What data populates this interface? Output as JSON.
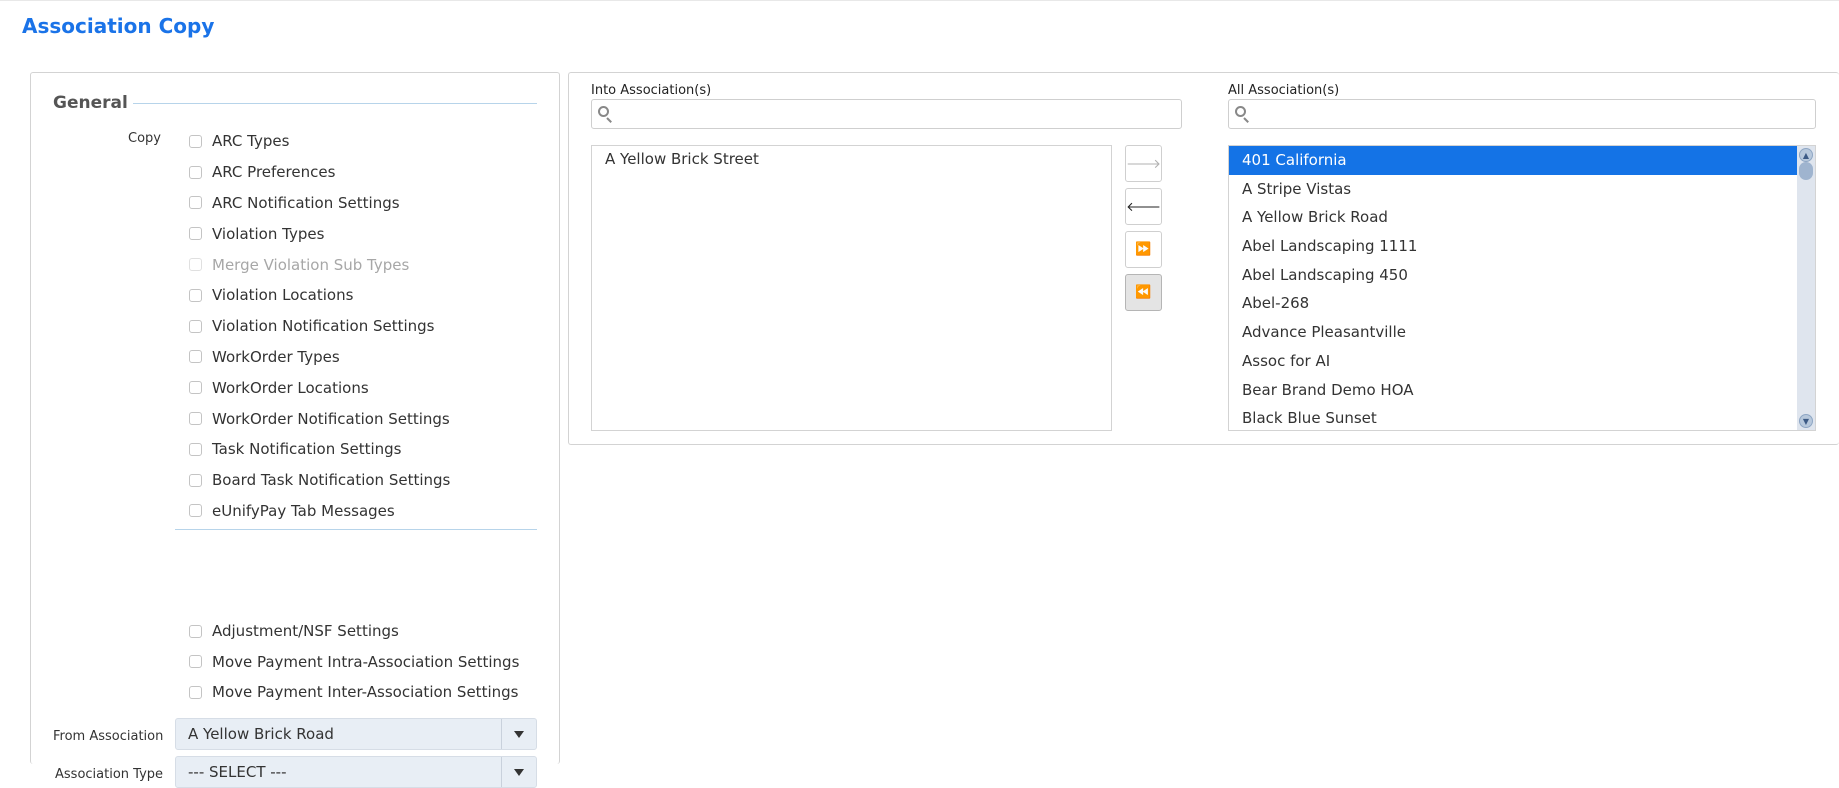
{
  "page": {
    "title": "Association Copy"
  },
  "general": {
    "legend": "General",
    "copy_label": "Copy",
    "copy_options": [
      {
        "label": "ARC Types",
        "disabled": false
      },
      {
        "label": "ARC Preferences",
        "disabled": false
      },
      {
        "label": "ARC Notification Settings",
        "disabled": false
      },
      {
        "label": "Violation Types",
        "disabled": false
      },
      {
        "label": "Merge Violation Sub Types",
        "disabled": true
      },
      {
        "label": "Violation Locations",
        "disabled": false
      },
      {
        "label": "Violation Notification Settings",
        "disabled": false
      },
      {
        "label": "WorkOrder Types",
        "disabled": false
      },
      {
        "label": "WorkOrder Locations",
        "disabled": false
      },
      {
        "label": "WorkOrder Notification Settings",
        "disabled": false
      },
      {
        "label": "Task Notification Settings",
        "disabled": false
      },
      {
        "label": "Board Task Notification Settings",
        "disabled": false
      },
      {
        "label": "eUnifyPay Tab Messages",
        "disabled": false
      }
    ],
    "payment_options": [
      {
        "label": "Adjustment/NSF Settings"
      },
      {
        "label": "Move Payment Intra-Association Settings"
      },
      {
        "label": "Move Payment Inter-Association Settings"
      }
    ],
    "from_association": {
      "label": "From Association",
      "value": "A Yellow Brick Road"
    },
    "association_type": {
      "label": "Association Type",
      "value": "--- SELECT ---"
    }
  },
  "into": {
    "label": "Into Association(s)",
    "search_value": "",
    "items": [
      "A Yellow Brick Street"
    ]
  },
  "all": {
    "label": "All Association(s)",
    "search_value": "",
    "items": [
      "401 California",
      "A Stripe Vistas",
      "A Yellow Brick Road",
      "Abel Landscaping 1111",
      "Abel Landscaping 450",
      "Abel-268",
      "Advance Pleasantville",
      "Assoc for AI",
      "Bear Brand Demo HOA",
      "Black Blue Sunset"
    ],
    "selected_index": 0
  },
  "move_buttons": [
    {
      "name": "move-right-button",
      "glyph": "🡒",
      "state": "disabled"
    },
    {
      "name": "move-left-button",
      "glyph": "🡐",
      "state": "normal"
    },
    {
      "name": "move-all-right-button",
      "glyph": "⏩",
      "state": "normal"
    },
    {
      "name": "move-all-left-button",
      "glyph": "⏪",
      "state": "pressed"
    }
  ],
  "colors": {
    "title": "#1a73e8",
    "selected_row": "#1473e6",
    "dropdown_bg": "#e8eef5"
  }
}
